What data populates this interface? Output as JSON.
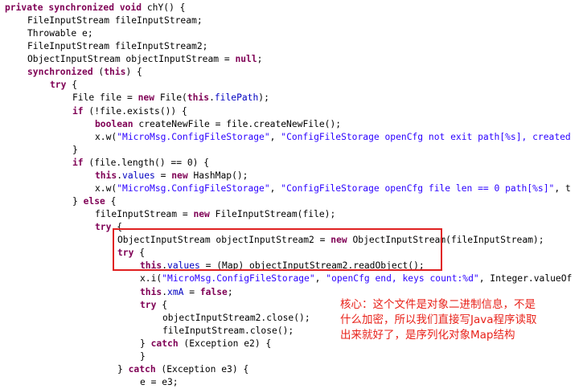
{
  "code_lines": [
    [
      [
        "kw",
        "private"
      ],
      [
        "pl",
        " "
      ],
      [
        "kw",
        "synchronized"
      ],
      [
        "pl",
        " "
      ],
      [
        "kw",
        "void"
      ],
      [
        "pl",
        " chY() {"
      ]
    ],
    [
      [
        "pl",
        "FileInputStream fileInputStream;"
      ]
    ],
    [
      [
        "pl",
        "Throwable e;"
      ]
    ],
    [
      [
        "pl",
        "FileInputStream fileInputStream2;"
      ]
    ],
    [
      [
        "pl",
        "ObjectInputStream objectInputStream = "
      ],
      [
        "kw",
        "null"
      ],
      [
        "pl",
        ";"
      ]
    ],
    [
      [
        "kw",
        "synchronized"
      ],
      [
        "pl",
        " ("
      ],
      [
        "kw",
        "this"
      ],
      [
        "pl",
        ") {"
      ]
    ],
    [
      [
        "kw",
        "try"
      ],
      [
        "pl",
        " {"
      ]
    ],
    [
      [
        "pl",
        "File file = "
      ],
      [
        "kw",
        "new"
      ],
      [
        "pl",
        " File("
      ],
      [
        "kw",
        "this"
      ],
      [
        "pl",
        "."
      ],
      [
        "field",
        "filePath"
      ],
      [
        "pl",
        ");"
      ]
    ],
    [
      [
        "kw",
        "if"
      ],
      [
        "pl",
        " (!file.exists()) {"
      ]
    ],
    [
      [
        "kw",
        "boolean"
      ],
      [
        "pl",
        " createNewFile = file.createNewFile();"
      ]
    ],
    [
      [
        "pl",
        "x.w("
      ],
      [
        "str",
        "\"MicroMsg.ConfigFileStorage\""
      ],
      [
        "pl",
        ", "
      ],
      [
        "str",
        "\"ConfigFileStorage openCfg not exit path[%s], created"
      ]
    ],
    [
      [
        "pl",
        "}"
      ]
    ],
    [
      [
        "kw",
        "if"
      ],
      [
        "pl",
        " (file.length() == 0) {"
      ]
    ],
    [
      [
        "kw",
        "this"
      ],
      [
        "pl",
        "."
      ],
      [
        "field",
        "values"
      ],
      [
        "pl",
        " = "
      ],
      [
        "kw",
        "new"
      ],
      [
        "pl",
        " HashMap();"
      ]
    ],
    [
      [
        "pl",
        "x.w("
      ],
      [
        "str",
        "\"MicroMsg.ConfigFileStorage\""
      ],
      [
        "pl",
        ", "
      ],
      [
        "str",
        "\"ConfigFileStorage openCfg file len == 0 path[%s]\""
      ],
      [
        "pl",
        ", t"
      ]
    ],
    [
      [
        "pl",
        "} "
      ],
      [
        "kw",
        "else"
      ],
      [
        "pl",
        " {"
      ]
    ],
    [
      [
        "pl",
        "fileInputStream = "
      ],
      [
        "kw",
        "new"
      ],
      [
        "pl",
        " FileInputStream(file);"
      ]
    ],
    [
      [
        "kw",
        "try"
      ],
      [
        "pl",
        " {"
      ]
    ],
    [
      [
        "pl",
        "ObjectInputStream objectInputStream2 = "
      ],
      [
        "kw",
        "new"
      ],
      [
        "pl",
        " ObjectInputStream(fileInputStream);"
      ]
    ],
    [
      [
        "kw",
        "try"
      ],
      [
        "pl",
        " {"
      ]
    ],
    [
      [
        "kw",
        "this"
      ],
      [
        "pl",
        "."
      ],
      [
        "field",
        "values"
      ],
      [
        "pl",
        " = (Map) objectInputStream2.readObject();"
      ]
    ],
    [
      [
        "pl",
        "x.i("
      ],
      [
        "str",
        "\"MicroMsg.ConfigFileStorage\""
      ],
      [
        "pl",
        ", "
      ],
      [
        "str",
        "\"openCfg end, keys count:%d\""
      ],
      [
        "pl",
        ", Integer.valueOf"
      ]
    ],
    [
      [
        "kw",
        "this"
      ],
      [
        "pl",
        "."
      ],
      [
        "field",
        "xmA"
      ],
      [
        "pl",
        " = "
      ],
      [
        "kw",
        "false"
      ],
      [
        "pl",
        ";"
      ]
    ],
    [
      [
        "kw",
        "try"
      ],
      [
        "pl",
        " {"
      ]
    ],
    [
      [
        "pl",
        "objectInputStream2.close();"
      ]
    ],
    [
      [
        "pl",
        "fileInputStream.close();"
      ]
    ],
    [
      [
        "pl",
        "} "
      ],
      [
        "kw",
        "catch"
      ],
      [
        "pl",
        " (Exception e2) {"
      ]
    ],
    [
      [
        "pl",
        "}"
      ]
    ],
    [
      [
        "pl",
        "} "
      ],
      [
        "kw",
        "catch"
      ],
      [
        "pl",
        " (Exception e3) {"
      ]
    ],
    [
      [
        "pl",
        "e = e3;"
      ]
    ]
  ],
  "annotation": {
    "text": "核心：这个文件是对象二进制信息，不是\n什么加密，所以我们直接写Java程序读取\n出来就好了，是序列化对象Map结构"
  },
  "colors": {
    "keyword": "#7f0055",
    "string": "#2a00ff",
    "field": "#0000c0",
    "annotation": "#e8231b",
    "highlight_border": "#e02020"
  }
}
